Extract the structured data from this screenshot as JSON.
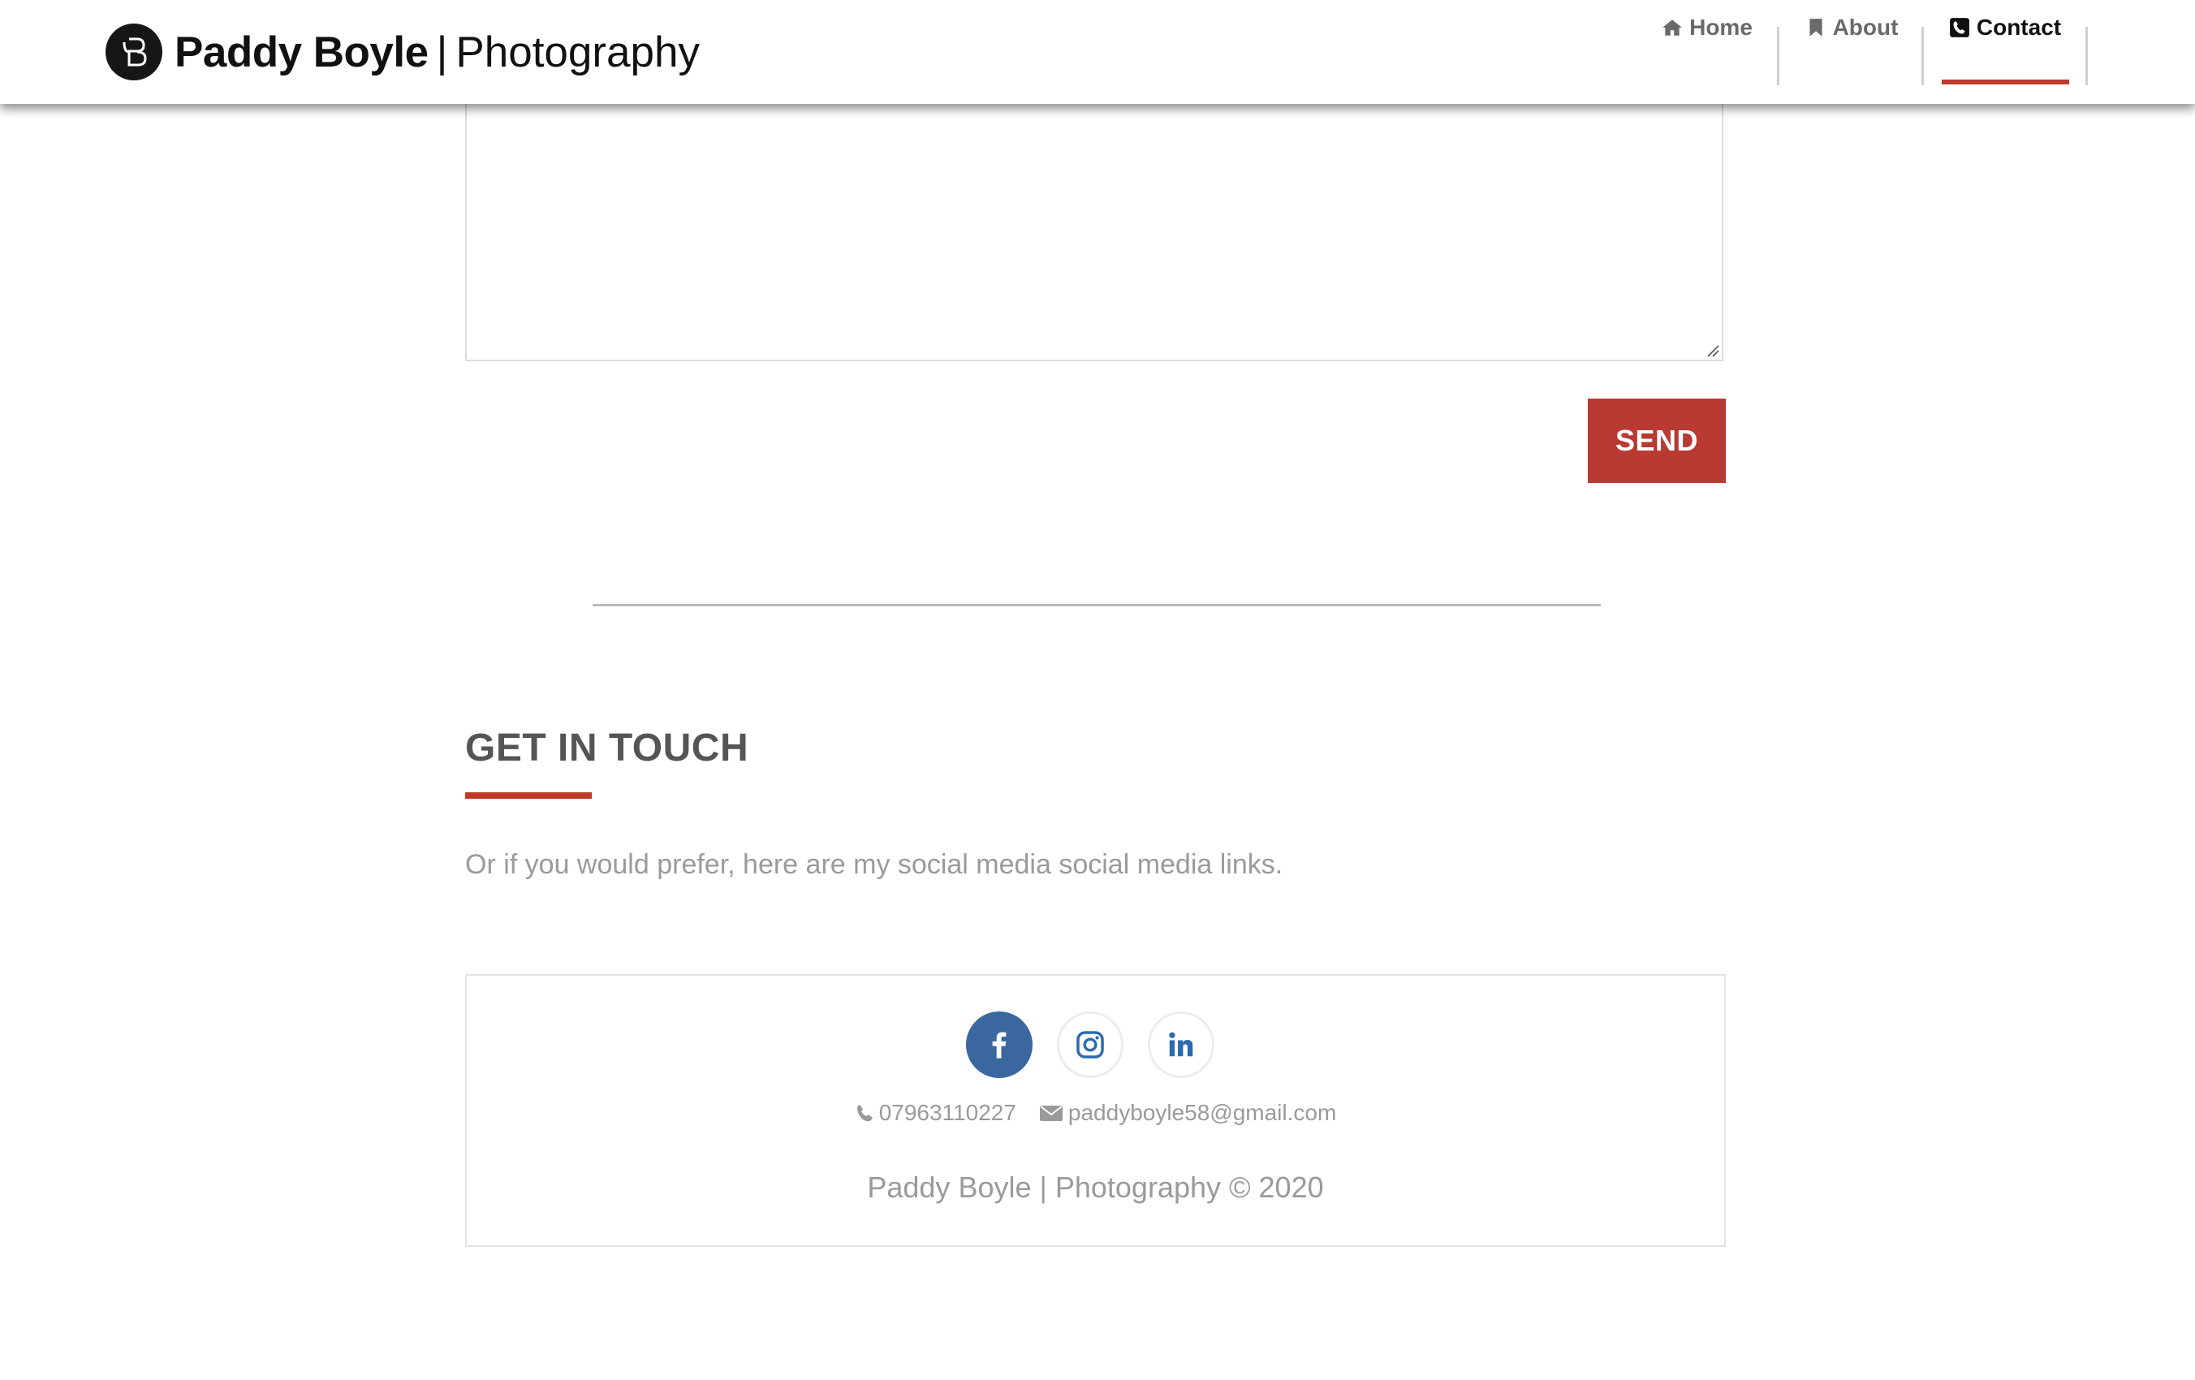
{
  "header": {
    "brand_name": "Paddy Boyle",
    "brand_separator": "|",
    "brand_subtitle": "Photography",
    "nav": [
      {
        "label": "Home",
        "icon": "home-icon",
        "active": false
      },
      {
        "label": "About",
        "icon": "bookmark-icon",
        "active": false
      },
      {
        "label": "Contact",
        "icon": "phone-square-icon",
        "active": true
      }
    ]
  },
  "form": {
    "message_value": "",
    "send_label": "SEND"
  },
  "contact_section": {
    "title": "GET IN TOUCH",
    "intro": "Or if you would prefer, here are my social media social media links."
  },
  "footer": {
    "social": [
      {
        "name": "facebook-icon"
      },
      {
        "name": "instagram-icon"
      },
      {
        "name": "linkedin-icon"
      }
    ],
    "phone": "07963110227",
    "email": "paddyboyle58@gmail.com",
    "copyright": "Paddy Boyle | Photography © 2020"
  },
  "colors": {
    "accent": "#c0392b",
    "send_button": "#b83a33",
    "facebook": "#3b67a0",
    "linkedin": "#2d6bb0",
    "muted_text": "#9a9a9a",
    "heading_text": "#555555"
  }
}
